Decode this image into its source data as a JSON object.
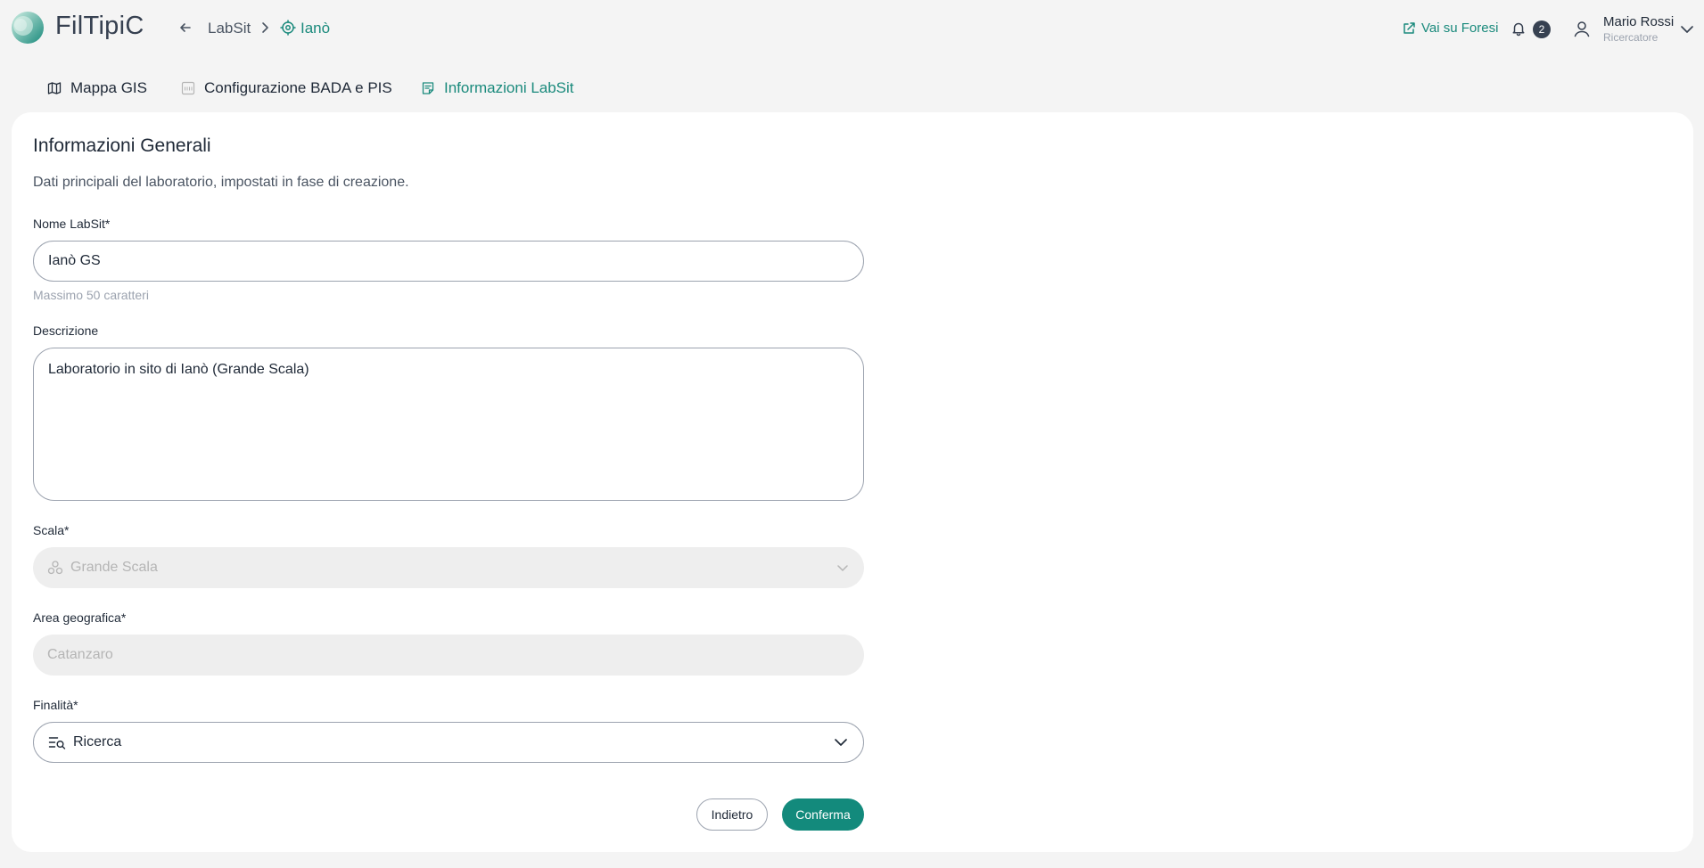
{
  "header": {
    "brand": "FilTipiC",
    "breadcrumb": {
      "parent": "LabSit",
      "current": "Ianò"
    },
    "external_link": "Vai su Foresi",
    "notifications_count": "2",
    "user": {
      "name": "Mario Rossi",
      "role": "Ricercatore"
    },
    "colors": {
      "accent": "#1a8a7c",
      "background": "#f4f4f4"
    }
  },
  "tabs": [
    {
      "label": "Mappa GIS",
      "icon": "map-icon",
      "active": false
    },
    {
      "label": "Configurazione BADA e PIS",
      "icon": "config-icon",
      "active": false
    },
    {
      "label": "Informazioni LabSit",
      "icon": "info-doc-icon",
      "active": true
    }
  ],
  "form": {
    "title": "Informazioni Generali",
    "subtitle": "Dati principali del laboratorio, impostati in fase di creazione.",
    "name": {
      "label": "Nome LabSit*",
      "value": "Ianò GS",
      "hint": "Massimo 50 caratteri"
    },
    "description": {
      "label": "Descrizione",
      "value": "Laboratorio in sito di Ianò (Grande Scala)"
    },
    "scale": {
      "label": "Scala*",
      "value": "Grande Scala",
      "disabled": true
    },
    "area": {
      "label": "Area geografica*",
      "value": "Catanzaro",
      "disabled": true
    },
    "purpose": {
      "label": "Finalità*",
      "value": "Ricerca"
    },
    "buttons": {
      "back": "Indietro",
      "confirm": "Conferma"
    }
  }
}
